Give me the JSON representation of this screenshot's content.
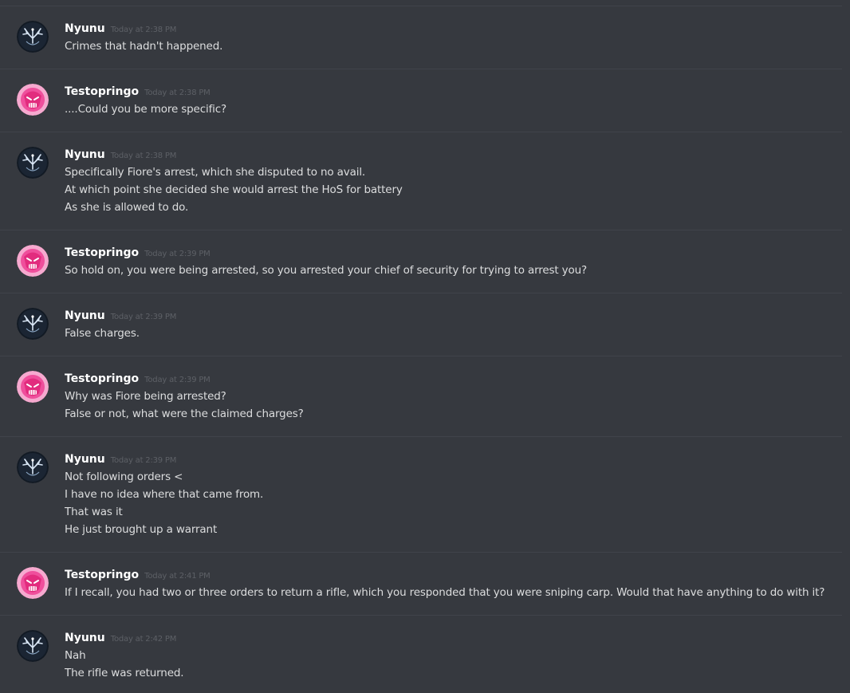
{
  "messages": [
    {
      "author": "Nyunu",
      "timestamp": "Today at 2:38 PM",
      "avatar": "nyunu-avatar",
      "lines": [
        "Crimes that hadn't happened."
      ]
    },
    {
      "author": "Testopringo",
      "timestamp": "Today at 2:38 PM",
      "avatar": "testopringo-avatar",
      "lines": [
        "....Could you be more specific?"
      ]
    },
    {
      "author": "Nyunu",
      "timestamp": "Today at 2:38 PM",
      "avatar": "nyunu-avatar",
      "lines": [
        "Specifically Fiore's arrest, which she disputed to no avail.",
        "At which point she decided she would arrest the HoS for battery",
        "As she is allowed to do."
      ]
    },
    {
      "author": "Testopringo",
      "timestamp": "Today at 2:39 PM",
      "avatar": "testopringo-avatar",
      "lines": [
        "So hold on, you were being arrested, so you arrested your chief of security for trying to arrest you?"
      ]
    },
    {
      "author": "Nyunu",
      "timestamp": "Today at 2:39 PM",
      "avatar": "nyunu-avatar",
      "lines": [
        "False charges."
      ]
    },
    {
      "author": "Testopringo",
      "timestamp": "Today at 2:39 PM",
      "avatar": "testopringo-avatar",
      "lines": [
        "Why was Fiore being arrested?",
        "False or not, what were the claimed charges?"
      ]
    },
    {
      "author": "Nyunu",
      "timestamp": "Today at 2:39 PM",
      "avatar": "nyunu-avatar",
      "lines": [
        "Not following orders <",
        "I have no idea where that came from.",
        "That was it",
        "He just brought up a warrant"
      ]
    },
    {
      "author": "Testopringo",
      "timestamp": "Today at 2:41 PM",
      "avatar": "testopringo-avatar",
      "lines": [
        "If I recall, you had two or three orders to return a rifle, which you responded that you were sniping carp. Would that have anything to do with it?"
      ]
    },
    {
      "author": "Nyunu",
      "timestamp": "Today at 2:42 PM",
      "avatar": "nyunu-avatar",
      "lines": [
        "Nah",
        "The rifle was returned."
      ]
    }
  ]
}
